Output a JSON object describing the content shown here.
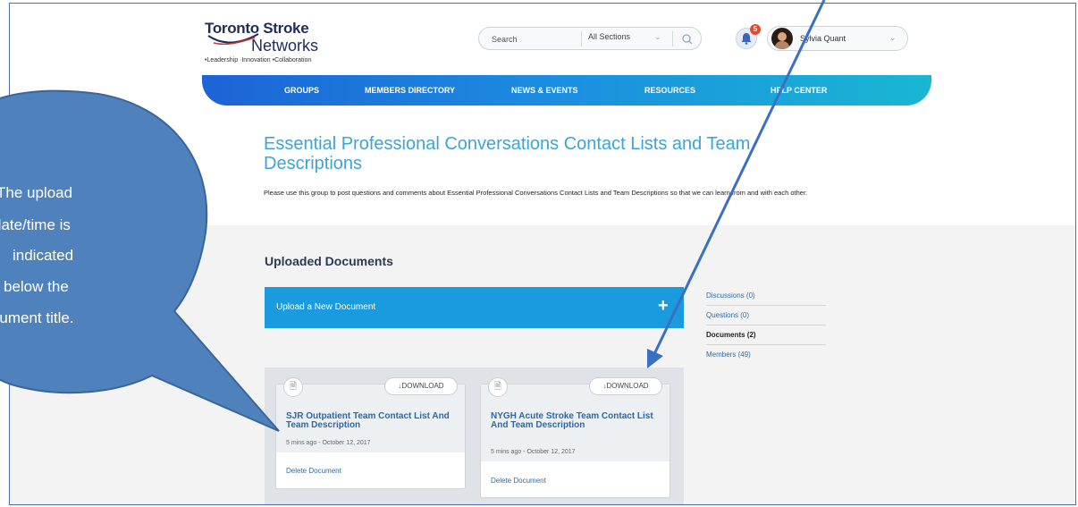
{
  "logo": {
    "title": "Toronto Stroke",
    "subtitle": "Networks",
    "tagline": "•Leadership  ·Innovation  •Collaboration"
  },
  "search": {
    "placeholder": "Search",
    "section": "All Sections"
  },
  "notifications": {
    "count": "5"
  },
  "user": {
    "name": "Sylvia Quant"
  },
  "nav": {
    "items": [
      "GROUPS",
      "MEMBERS DIRECTORY",
      "NEWS & EVENTS",
      "RESOURCES",
      "HELP CENTER"
    ]
  },
  "page": {
    "title": "Essential Professional Conversations Contact Lists and Team Descriptions",
    "description": "Please use this group to post questions and comments about Essential Professional Conversations Contact Lists and Team Descriptions so that we can learn from and with each other."
  },
  "documents": {
    "heading": "Uploaded Documents",
    "upload_label": "Upload a New Document",
    "upload_icon": "+",
    "cards": [
      {
        "title": "SJR Outpatient Team Contact List And Team Description",
        "date": "5 mins ago - October 12, 2017",
        "download": "DOWNLOAD",
        "delete": "Delete Document"
      },
      {
        "title": "NYGH Acute Stroke Team Contact List And Team Description",
        "date": "5 mins ago - October 12, 2017",
        "download": "DOWNLOAD",
        "delete": "Delete Document"
      }
    ]
  },
  "side_nav": {
    "items": [
      "Discussions (0)",
      "Questions (0)",
      "Documents (2)",
      "Members (49)"
    ],
    "active": "Documents (2)"
  },
  "callout": {
    "lines": [
      "The upload",
      "date/time is",
      "indicated",
      "below the",
      "document title."
    ],
    "color": "#4f81bd"
  },
  "colors": {
    "accent": "#1a9bdf",
    "title": "#3ba4d8",
    "nav_start": "#1d63d6",
    "nav_end": "#19b7d3"
  }
}
